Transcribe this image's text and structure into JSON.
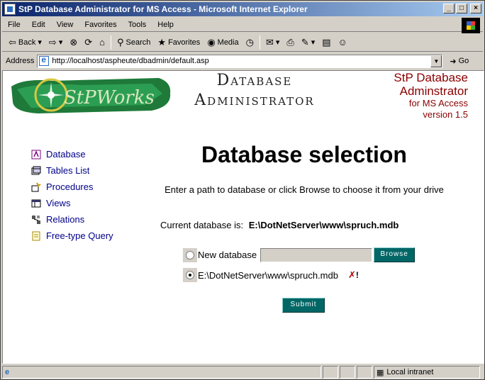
{
  "window": {
    "title": "StP Database Administrator for MS Access - Microsoft Internet Explorer",
    "minimize": "_",
    "maximize": "□",
    "close": "×"
  },
  "menu": [
    "File",
    "Edit",
    "View",
    "Favorites",
    "Tools",
    "Help"
  ],
  "toolbar": {
    "back": "Back",
    "search": "Search",
    "favorites": "Favorites",
    "media": "Media"
  },
  "address": {
    "label": "Address",
    "url": "http://localhost/aspheute/dbadmin/default.asp",
    "go": "Go"
  },
  "banner": {
    "logo_text": "StPWorks",
    "title_line1": "Database",
    "title_line2": "Administrator",
    "right_line1": "StP Database",
    "right_line2": "Adminstrator",
    "right_line3": "for MS Access",
    "right_line4": "version 1.5"
  },
  "nav": [
    {
      "label": "Database",
      "icon": "database-icon"
    },
    {
      "label": "Tables List",
      "icon": "tables-icon"
    },
    {
      "label": "Procedures",
      "icon": "procedures-icon"
    },
    {
      "label": "Views",
      "icon": "views-icon"
    },
    {
      "label": "Relations",
      "icon": "relations-icon"
    },
    {
      "label": "Free-type Query",
      "icon": "query-icon"
    }
  ],
  "main": {
    "title": "Database selection",
    "hint": "Enter a path to database or click Browse to choose it from your drive",
    "current_label": "Current database is:",
    "current_value": "E:\\DotNetServer\\www\\spruch.mdb",
    "new_db_label": "New database",
    "new_db_value": "",
    "browse": "Browse",
    "existing_db_label": "E:\\DotNetServer\\www\\spruch.mdb",
    "delete_mark": "!",
    "submit": "Submit"
  },
  "status": {
    "zone": "Local intranet"
  },
  "colors": {
    "button_bg": "#006666",
    "banner_red": "#8b0000",
    "nav_link": "#00008b"
  }
}
